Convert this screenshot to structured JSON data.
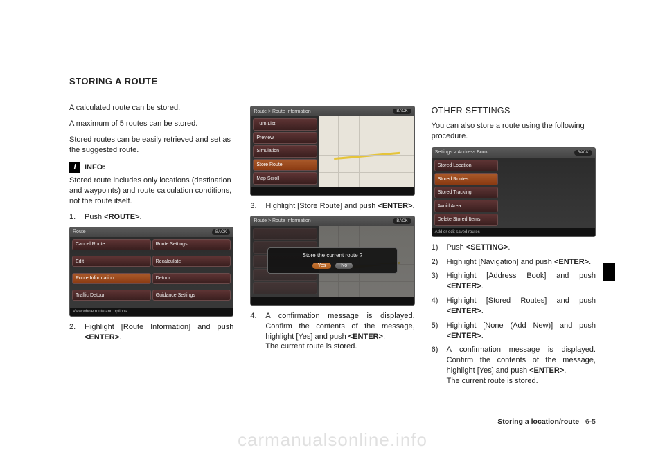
{
  "title": "STORING A ROUTE",
  "col1": {
    "p1": "A calculated route can be stored.",
    "p2": "A maximum of 5 routes can be stored.",
    "p3": "Stored routes can be easily retrieved and set as the suggested route.",
    "info_label": "INFO:",
    "info_text": "Stored route includes only locations (destination and waypoints) and route calculation conditions, not the route itself.",
    "step1_num": "1.",
    "step1_text_a": "Push ",
    "step1_text_b": "<ROUTE>",
    "step1_text_c": ".",
    "shot1": {
      "title": "Route",
      "back": "BACK",
      "btns": [
        "Cancel Route",
        "Route Settings",
        "Edit",
        "Recalculate",
        "Route Information",
        "Detour",
        "Traffic Detour",
        "Guidance Settings"
      ],
      "selected": "Route Information",
      "status": "View whole route and options"
    },
    "step2_num": "2.",
    "step2_text_a": "Highlight [Route Information] and push ",
    "step2_text_b": "<ENTER>",
    "step2_text_c": "."
  },
  "col2": {
    "shot2": {
      "title": "Route > Route Information",
      "back": "BACK",
      "btns": [
        "Turn List",
        "Preview",
        "Simulation",
        "Store Route",
        "Map Scroll"
      ],
      "selected": "Store Route"
    },
    "step3_num": "3.",
    "step3_text_a": "Highlight [Store Route] and push ",
    "step3_text_b": "<ENTER>",
    "step3_text_c": ".",
    "shot3": {
      "title": "Route > Route Information",
      "back": "BACK",
      "dialog_text": "Store the current route ?",
      "yes": "Yes",
      "no": "No"
    },
    "step4_num": "4.",
    "step4_text": "A confirmation message is displayed. Confirm the contents of the message, highlight [Yes] and push ",
    "step4_b": "<ENTER>",
    "step4_c": ".",
    "step4_d": "The current route is stored."
  },
  "col3": {
    "heading": "OTHER SETTINGS",
    "intro": "You can also store a route using the following procedure.",
    "shot4": {
      "title": "Settings > Address Book",
      "back": "BACK",
      "btns": [
        "Stored Location",
        "Stored Routes",
        "Stored Tracking",
        "Avoid Area",
        "Delete Stored Items"
      ],
      "selected": "Stored Routes",
      "status": "Add or edit saved routes"
    },
    "s1_num": "1)",
    "s1_a": "Push ",
    "s1_b": "<SETTING>",
    "s1_c": ".",
    "s2_num": "2)",
    "s2_a": "Highlight [Navigation] and push ",
    "s2_b": "<ENTER>",
    "s2_c": ".",
    "s3_num": "3)",
    "s3_a": "Highlight [Address Book] and push ",
    "s3_b": "<ENTER>",
    "s3_c": ".",
    "s4_num": "4)",
    "s4_a": "Highlight [Stored Routes] and push ",
    "s4_b": "<ENTER>",
    "s4_c": ".",
    "s5_num": "5)",
    "s5_a": "Highlight [None (Add New)] and push ",
    "s5_b": "<ENTER>",
    "s5_c": ".",
    "s6_num": "6)",
    "s6_a": "A confirmation message is displayed. Confirm the contents of the message, highlight [Yes] and push ",
    "s6_b": "<ENTER>",
    "s6_c": ".",
    "s6_d": "The current route is stored."
  },
  "footer_a": "Storing a location/route",
  "footer_b": "6-5",
  "watermark": "carmanualsonline.info"
}
